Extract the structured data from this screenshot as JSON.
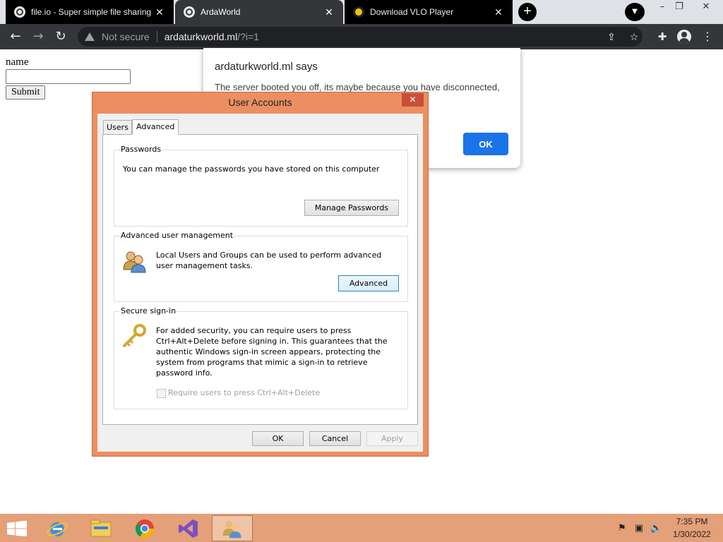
{
  "browser": {
    "tabs": [
      {
        "title": "file.io - Super simple file sharing",
        "icon": "globe-icon"
      },
      {
        "title": "ArdaWorld",
        "icon": "globe-icon"
      },
      {
        "title": "Download VLO Player",
        "icon": "vlo-player-icon"
      }
    ],
    "new_tab_symbol": "+",
    "omnibox": {
      "security_text": "Not secure",
      "host": "ardaturkworld.ml",
      "path": "/?i=1"
    }
  },
  "page": {
    "form": {
      "label": "name",
      "input_value": "",
      "submit_label": "Submit"
    }
  },
  "alert": {
    "title": "ardaturkworld.ml says",
    "message": "The server booted you off, its maybe because you have disconnected,",
    "ok_label": "OK",
    "ok_color": "#1a73e8"
  },
  "user_accounts": {
    "title": "User Accounts",
    "tabs": [
      "Users",
      "Advanced"
    ],
    "selected_tab": "Advanced",
    "passwords": {
      "legend": "Passwords",
      "text": "You can manage the passwords you have stored on this computer",
      "button": "Manage Passwords"
    },
    "advanced_mgmt": {
      "legend": "Advanced user management",
      "text": "Local Users and Groups can be used to perform advanced user management tasks.",
      "button": "Advanced"
    },
    "secure_signin": {
      "legend": "Secure sign-in",
      "text": "For added security, you can require users to press Ctrl+Alt+Delete before signing in. This guarantees that the authentic Windows sign-in screen appears, protecting the system from programs that mimic a sign-in to retrieve password info.",
      "checkbox_label": "Require users to press Ctrl+Alt+Delete",
      "checkbox_checked": false
    },
    "buttons": {
      "ok": "OK",
      "cancel": "Cancel",
      "apply": "Apply"
    }
  },
  "taskbar": {
    "apps": [
      "internet-explorer-icon",
      "file-explorer-icon",
      "chrome-icon",
      "visual-studio-icon",
      "user-accounts-icon"
    ],
    "time": "7:35 PM",
    "date": "1/30/2022",
    "accent": "#e4a078"
  }
}
